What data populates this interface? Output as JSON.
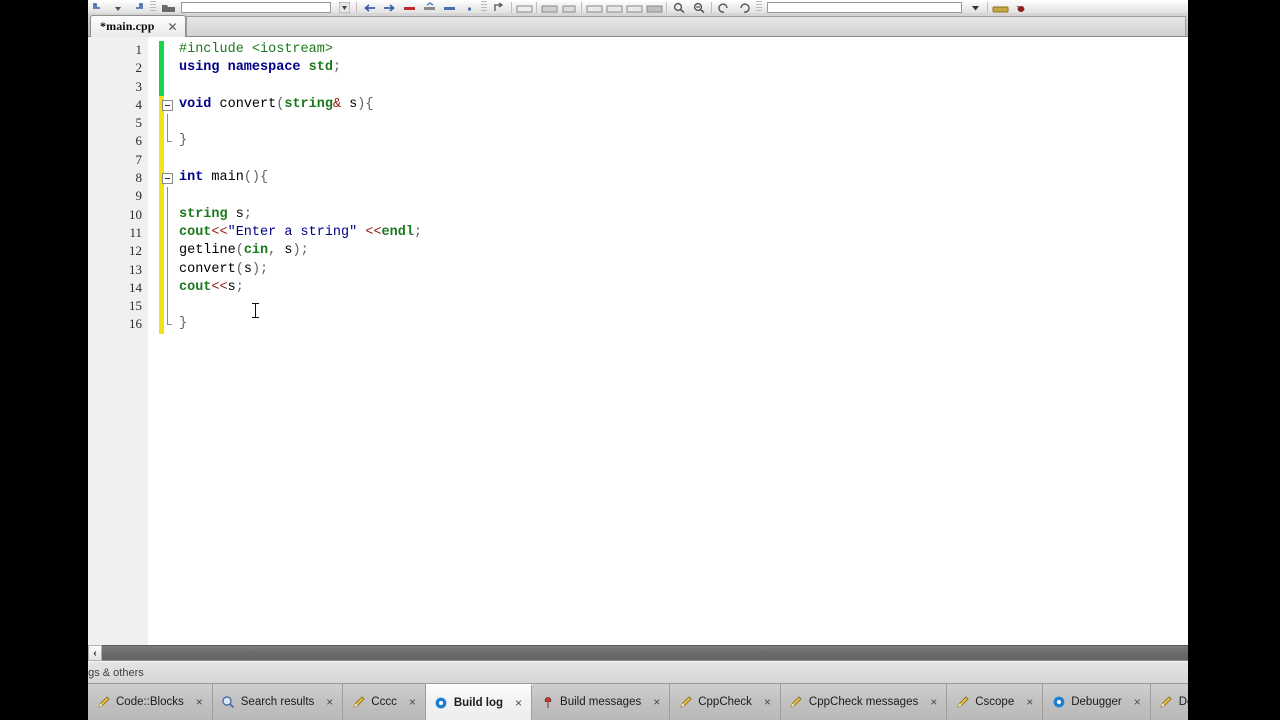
{
  "window": {
    "editor_tab": {
      "label": "*main.cpp",
      "close_icon": "close-icon"
    }
  },
  "toolbar": {
    "search_value": "",
    "search_placeholder": "",
    "scope_value": "",
    "scope_placeholder": ""
  },
  "editor": {
    "line_numbers": [
      "1",
      "2",
      "3",
      "4",
      "5",
      "6",
      "7",
      "8",
      "9",
      "10",
      "11",
      "12",
      "13",
      "14",
      "15",
      "16"
    ],
    "change_markers": [
      {
        "color": "#15d44a",
        "lines": 3
      },
      {
        "color": "#f2e21a",
        "lines": 13
      }
    ],
    "lines": [
      {
        "num": "1",
        "tokens": [
          {
            "t": "#include ",
            "c": "prep"
          },
          {
            "t": "<iostream>",
            "c": "prephdr"
          }
        ]
      },
      {
        "num": "2",
        "tokens": [
          {
            "t": "using ",
            "c": "kw"
          },
          {
            "t": "namespace ",
            "c": "kw"
          },
          {
            "t": "std",
            "c": "type"
          },
          {
            "t": ";",
            "c": "punc"
          }
        ]
      },
      {
        "num": "3",
        "tokens": []
      },
      {
        "num": "4",
        "tokens": [
          {
            "t": "void ",
            "c": "kw"
          },
          {
            "t": "convert",
            "c": "plain"
          },
          {
            "t": "(",
            "c": "punc"
          },
          {
            "t": "string",
            "c": "type"
          },
          {
            "t": "&",
            "c": "op"
          },
          {
            "t": " s",
            "c": "plain"
          },
          {
            "t": ")",
            "c": "punc"
          },
          {
            "t": "{",
            "c": "brace"
          }
        ]
      },
      {
        "num": "5",
        "tokens": []
      },
      {
        "num": "6",
        "tokens": [
          {
            "t": "}",
            "c": "brace"
          }
        ]
      },
      {
        "num": "7",
        "tokens": []
      },
      {
        "num": "8",
        "tokens": [
          {
            "t": "int ",
            "c": "kw"
          },
          {
            "t": "main",
            "c": "plain"
          },
          {
            "t": "()",
            "c": "punc"
          },
          {
            "t": "{",
            "c": "brace"
          }
        ]
      },
      {
        "num": "9",
        "tokens": []
      },
      {
        "num": "10",
        "tokens": [
          {
            "t": "string",
            "c": "type"
          },
          {
            "t": " s",
            "c": "plain"
          },
          {
            "t": ";",
            "c": "punc"
          }
        ]
      },
      {
        "num": "11",
        "tokens": [
          {
            "t": "cout",
            "c": "type"
          },
          {
            "t": "<<",
            "c": "op"
          },
          {
            "t": "\"Enter a string\"",
            "c": "str"
          },
          {
            "t": " ",
            "c": "plain"
          },
          {
            "t": "<<",
            "c": "op"
          },
          {
            "t": "endl",
            "c": "type"
          },
          {
            "t": ";",
            "c": "punc"
          }
        ]
      },
      {
        "num": "12",
        "tokens": [
          {
            "t": "getline",
            "c": "plain"
          },
          {
            "t": "(",
            "c": "punc"
          },
          {
            "t": "cin",
            "c": "type"
          },
          {
            "t": ",",
            "c": "punc"
          },
          {
            "t": " s",
            "c": "plain"
          },
          {
            "t": ")",
            "c": "punc"
          },
          {
            "t": ";",
            "c": "punc"
          }
        ]
      },
      {
        "num": "13",
        "tokens": [
          {
            "t": "convert",
            "c": "plain"
          },
          {
            "t": "(",
            "c": "punc"
          },
          {
            "t": "s",
            "c": "plain"
          },
          {
            "t": ")",
            "c": "punc"
          },
          {
            "t": ";",
            "c": "punc"
          }
        ]
      },
      {
        "num": "14",
        "tokens": [
          {
            "t": "cout",
            "c": "type"
          },
          {
            "t": "<<",
            "c": "op"
          },
          {
            "t": "s",
            "c": "plain"
          },
          {
            "t": ";",
            "c": "punc"
          }
        ]
      },
      {
        "num": "15",
        "tokens": []
      },
      {
        "num": "16",
        "tokens": [
          {
            "t": "}",
            "c": "brace"
          }
        ]
      }
    ],
    "fold_points": [
      "4",
      "8"
    ],
    "fold_ends": [
      "6",
      "16"
    ],
    "mouse_cursor": "text-ibeam-cursor"
  },
  "scrollbar": {
    "left_arrow": "‹",
    "thumb_percent": 100
  },
  "logs_panel": {
    "title": "ogs & others"
  },
  "bottom_tabs": [
    {
      "label": "Code::Blocks",
      "icon": "pencil-icon",
      "active": false,
      "close": "×"
    },
    {
      "label": "Search results",
      "icon": "magnifier-icon",
      "active": false,
      "close": "×"
    },
    {
      "label": "Cccc",
      "icon": "pencil-icon",
      "active": false,
      "close": "×"
    },
    {
      "label": "Build log",
      "icon": "gear-icon",
      "active": true,
      "close": "×"
    },
    {
      "label": "Build messages",
      "icon": "pin-icon",
      "active": false,
      "close": "×"
    },
    {
      "label": "CppCheck",
      "icon": "pencil-icon",
      "active": false,
      "close": "×"
    },
    {
      "label": "CppCheck messages",
      "icon": "pencil-icon",
      "active": false,
      "close": "×"
    },
    {
      "label": "Cscope",
      "icon": "pencil-icon",
      "active": false,
      "close": "×"
    },
    {
      "label": "Debugger",
      "icon": "gear-icon",
      "active": false,
      "close": "×"
    },
    {
      "label": "DoxyBlocks",
      "icon": "pencil-icon",
      "active": false,
      "close": "×"
    }
  ],
  "colors": {
    "accent_blue": "#1f6fc4",
    "marker_saved": "#15d44a",
    "marker_unsaved": "#f2e21a",
    "keyword": "#00008b",
    "type": "#1a7a1a",
    "string": "#00008b",
    "operator": "#8b1a1a"
  }
}
